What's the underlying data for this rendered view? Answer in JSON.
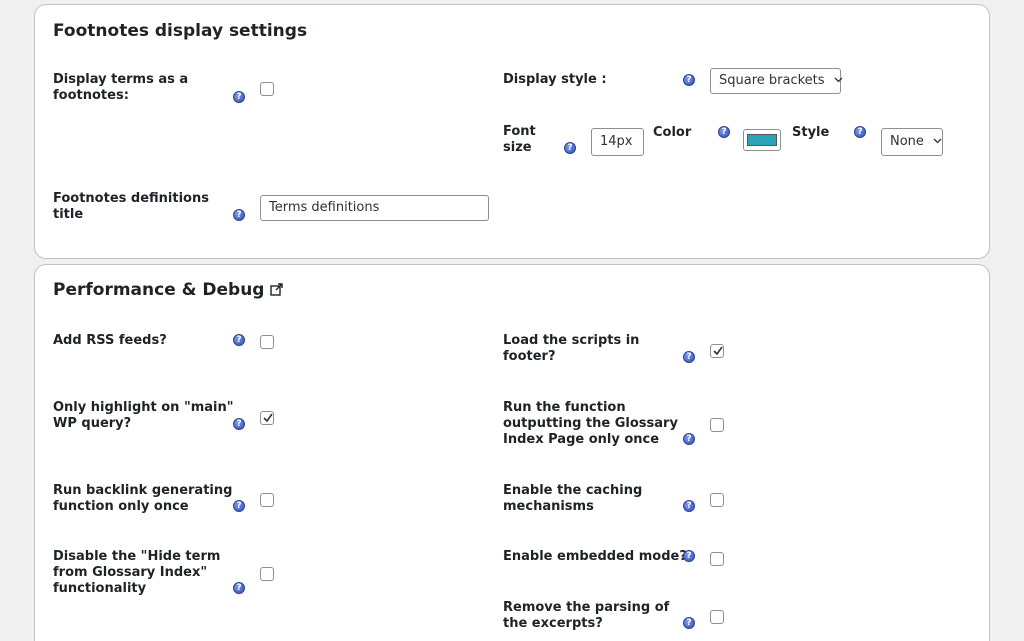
{
  "footnotes": {
    "title": "Footnotes display settings",
    "display_terms_label_1": "Display terms as a",
    "display_terms_label_2": "footnotes:",
    "display_terms_checked": false,
    "display_style_label": "Display style :",
    "display_style_value": "Square brackets",
    "font_size_label_1": "Font",
    "font_size_label_2": "size",
    "font_size_value": "14px",
    "color_label": "Color",
    "color_value": "#2ba3b8",
    "style_label": "Style",
    "style_value": "None",
    "definitions_title_label_1": "Footnotes definitions",
    "definitions_title_label_2": "title",
    "definitions_title_value": "Terms definitions"
  },
  "performance": {
    "title": "Performance & Debug",
    "rss_label": "Add RSS feeds?",
    "rss_checked": false,
    "load_footer_label_1": "Load the scripts in",
    "load_footer_label_2": "footer?",
    "load_footer_checked": true,
    "main_query_label_1": "Only highlight on \"main\"",
    "main_query_label_2": "WP query?",
    "main_query_checked": true,
    "run_index_label_1": "Run the function",
    "run_index_label_2": "outputting the Glossary",
    "run_index_label_3": "Index Page only once",
    "run_index_checked": false,
    "backlink_label_1": "Run backlink generating",
    "backlink_label_2": "function only once",
    "backlink_checked": false,
    "caching_label_1": "Enable the caching",
    "caching_label_2": "mechanisms",
    "caching_checked": false,
    "hide_term_label_1": "Disable the \"Hide term",
    "hide_term_label_2": "from Glossary Index\"",
    "hide_term_label_3": "functionality",
    "hide_term_checked": false,
    "embedded_label": "Enable embedded mode?",
    "embedded_checked": false,
    "excerpts_label_1": "Remove the parsing of",
    "excerpts_label_2": "the excerpts?",
    "excerpts_checked": false
  },
  "icons": {
    "help": "help-question-icon",
    "external": "external-link-icon",
    "check": "checkmark-icon",
    "chevron": "chevron-down-icon"
  }
}
